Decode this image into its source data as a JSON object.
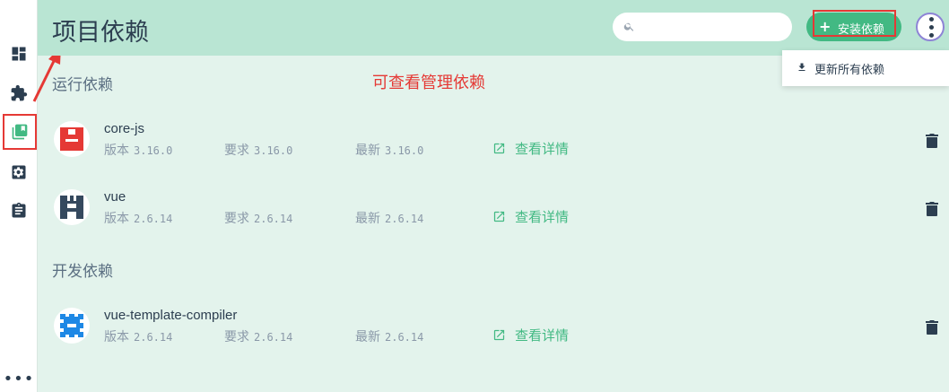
{
  "header": {
    "title": "项目依赖",
    "search_placeholder": "",
    "install_label": "安装依赖",
    "more_icon": "more-vert-icon"
  },
  "menu": {
    "update_all_label": "更新所有依赖"
  },
  "annotation": "可查看管理依赖",
  "sections": {
    "runtime": "运行依赖",
    "dev": "开发依赖"
  },
  "labels": {
    "version": "版本",
    "required": "要求",
    "latest": "最新",
    "details": "查看详情"
  },
  "dependencies": [
    {
      "name": "core-js",
      "version": "3.16.0",
      "required": "3.16.0",
      "latest": "3.16.0"
    },
    {
      "name": "vue",
      "version": "2.6.14",
      "required": "2.6.14",
      "latest": "2.6.14"
    },
    {
      "name": "vue-template-compiler",
      "version": "2.6.14",
      "required": "2.6.14",
      "latest": "2.6.14"
    }
  ],
  "sidebar": {
    "items": [
      {
        "icon": "dashboard-icon"
      },
      {
        "icon": "puzzle-icon"
      },
      {
        "icon": "library-icon",
        "active": true
      },
      {
        "icon": "gear-icon"
      },
      {
        "icon": "clipboard-icon"
      }
    ],
    "more": "•••"
  },
  "colors": {
    "accent": "#42b983",
    "highlight": "#e53935",
    "header_bg": "#b9e5d3",
    "content_bg": "#e3f3ec"
  }
}
